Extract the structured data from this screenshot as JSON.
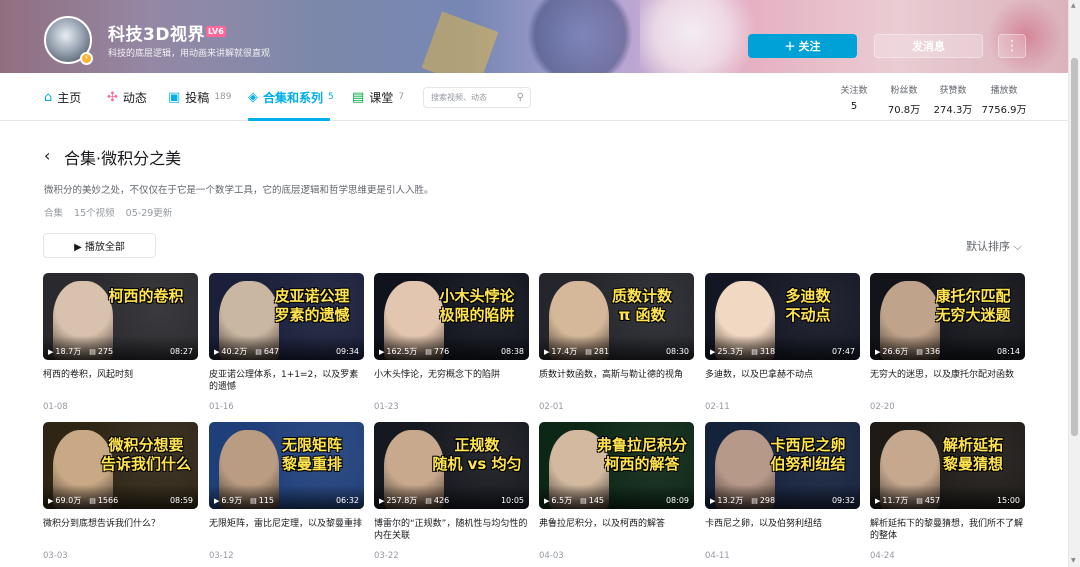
{
  "profile": {
    "name": "科技3D视界",
    "level": "LV6",
    "sign": "科技的底层逻辑，用动画来讲解就很直观",
    "follow_label": "＋ 关注",
    "message_label": "发消息",
    "more_label": "⋮"
  },
  "nav": {
    "items": [
      {
        "label": "主页",
        "icon": "⌂",
        "count": ""
      },
      {
        "label": "动态",
        "icon": "✣",
        "count": ""
      },
      {
        "label": "投稿",
        "icon": "▣",
        "count": "189"
      },
      {
        "label": "合集和系列",
        "icon": "◈",
        "count": "5"
      },
      {
        "label": "课堂",
        "icon": "▤",
        "count": "7"
      }
    ],
    "search_placeholder": "搜索视频、动态",
    "stats": [
      {
        "label": "关注数",
        "value": "5"
      },
      {
        "label": "粉丝数",
        "value": "70.8万"
      },
      {
        "label": "获赞数",
        "value": "274.3万"
      },
      {
        "label": "播放数",
        "value": "7756.9万"
      }
    ]
  },
  "collection": {
    "title": "合集·微积分之美",
    "description": "微积分的美妙之处，不仅仅在于它是一个数学工具，它的底层逻辑和哲学思维更是引人入胜。",
    "type": "合集",
    "video_count": "15个视频",
    "updated": "05-29更新",
    "play_all": "▶ 播放全部",
    "sort": "默认排序 ⌵"
  },
  "colors": {
    "accent": "#00aeec",
    "follow": "#00a1d6",
    "badge": "#ff6699"
  },
  "videos": [
    {
      "thumb_text": "柯西的卷积",
      "views": "18.7万",
      "comments": "275",
      "duration": "08:27",
      "title": "柯西的卷积，风起时刻",
      "date": "01-08",
      "bg": "#2a2a2e",
      "face": "#d8c2ad"
    },
    {
      "thumb_text": "皮亚诺公理\n罗素的遗憾",
      "views": "40.2万",
      "comments": "647",
      "duration": "09:34",
      "title": "皮亚诺公理体系，1+1=2，以及罗素的遗憾",
      "date": "01-16",
      "bg": "#1a1f3a",
      "face": "#c9b7a2"
    },
    {
      "thumb_text": "小木头悖论\n极限的陷阱",
      "views": "162.5万",
      "comments": "776",
      "duration": "08:38",
      "title": "小木头悖论，无穷概念下的陷阱",
      "date": "01-23",
      "bg": "#10131c",
      "face": "#e3c6b0"
    },
    {
      "thumb_text": "质数计数\nπ 函数",
      "views": "17.4万",
      "comments": "281",
      "duration": "08:30",
      "title": "质数计数函数，高斯与勒让德的视角",
      "date": "02-01",
      "bg": "#25262c",
      "face": "#d5b89a"
    },
    {
      "thumb_text": "多迪数\n不动点",
      "views": "25.3万",
      "comments": "318",
      "duration": "07:47",
      "title": "多迪数，以及巴拿赫不动点",
      "date": "02-11",
      "bg": "#131623",
      "face": "#f1d8c2"
    },
    {
      "thumb_text": "康托尔匹配\n无穷大迷题",
      "views": "26.6万",
      "comments": "336",
      "duration": "08:14",
      "title": "无穷大的迷思，以及康托尔配对函数",
      "date": "02-20",
      "bg": "#121419",
      "face": "#bfa48b"
    },
    {
      "thumb_text": "微积分想要\n告诉我们什么",
      "views": "69.0万",
      "comments": "1566",
      "duration": "08:59",
      "title": "微积分到底想告诉我们什么？",
      "date": "03-03",
      "bg": "#2e2515",
      "face": "#c9a985"
    },
    {
      "thumb_text": "无限矩阵\n黎曼重排",
      "views": "6.9万",
      "comments": "115",
      "duration": "06:32",
      "title": "无限矩阵，雷比尼定理，以及黎曼重排",
      "date": "03-12",
      "bg": "#1f3f7a",
      "face": "#b99c82"
    },
    {
      "thumb_text": "正规数\n随机 vs 均匀",
      "views": "257.8万",
      "comments": "426",
      "duration": "10:05",
      "title": "博雷尔的“正规数”，随机性与均匀性的内在关联",
      "date": "03-22",
      "bg": "#16181f",
      "face": "#c8a98d"
    },
    {
      "thumb_text": "弗鲁拉尼积分\n柯西的解答",
      "views": "6.5万",
      "comments": "145",
      "duration": "08:09",
      "title": "弗鲁拉尼积分，以及柯西的解答",
      "date": "04-03",
      "bg": "#0c2716",
      "face": "#d2b9a0"
    },
    {
      "thumb_text": "卡西尼之卵\n伯努利纽结",
      "views": "13.2万",
      "comments": "298",
      "duration": "09:32",
      "title": "卡西尼之卵，以及伯努利纽结",
      "date": "04-11",
      "bg": "#15223c",
      "face": "#b7998a"
    },
    {
      "thumb_text": "解析延拓\n黎曼猜想",
      "views": "11.7万",
      "comments": "457",
      "duration": "15:00",
      "title": "解析延拓下的黎曼猜想，我们所不了解的整体",
      "date": "04-24",
      "bg": "#1e1b17",
      "face": "#c5a88e"
    }
  ]
}
